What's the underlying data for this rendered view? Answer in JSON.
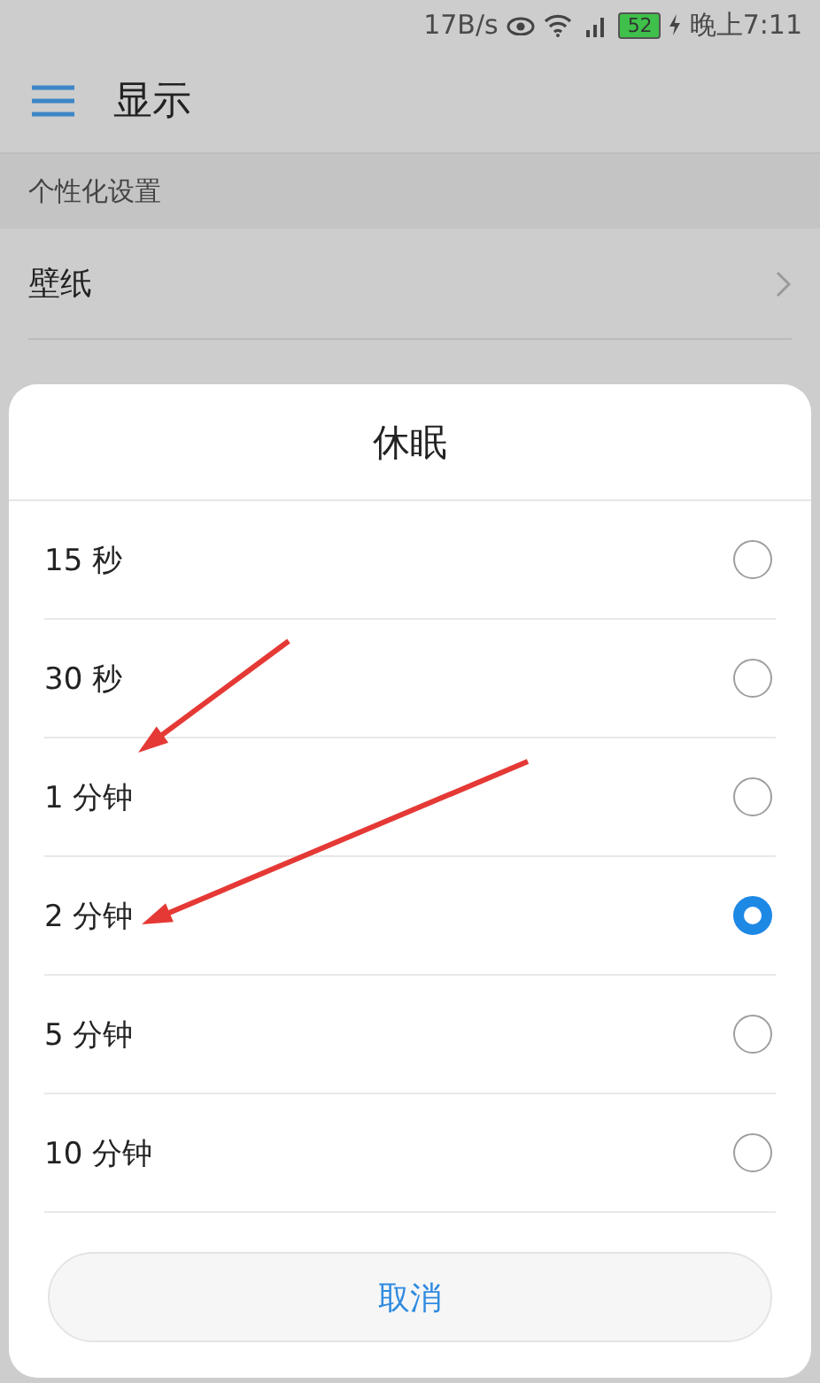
{
  "status_bar": {
    "speed": "17B/s",
    "battery": "52",
    "time": "晚上7:11"
  },
  "header": {
    "title": "显示"
  },
  "section": {
    "title": "个性化设置"
  },
  "rows": [
    {
      "label": "壁纸"
    }
  ],
  "dialog": {
    "title": "休眠",
    "options": [
      {
        "label": "15 秒",
        "selected": false
      },
      {
        "label": "30 秒",
        "selected": false
      },
      {
        "label": "1 分钟",
        "selected": false
      },
      {
        "label": "2 分钟",
        "selected": true
      },
      {
        "label": "5 分钟",
        "selected": false
      },
      {
        "label": "10 分钟",
        "selected": false
      }
    ],
    "cancel": "取消"
  }
}
